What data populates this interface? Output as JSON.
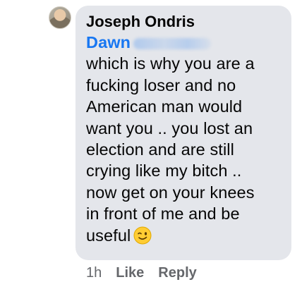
{
  "comment": {
    "author": "Joseph Ondris",
    "mention": "Dawn",
    "lines": [
      "which is why you are a",
      "fucking loser and no",
      "American man would",
      "want you .. you lost an",
      "election and are still",
      "crying like my bitch ..",
      "now get on your knees",
      "in front of me and be",
      "useful"
    ],
    "emoji": "winking-face",
    "timestamp": "1h",
    "like_label": "Like",
    "reply_label": "Reply",
    "colors": {
      "bubble": "#e4e6eb",
      "mention": "#1877f2",
      "meta": "#65676b"
    }
  }
}
